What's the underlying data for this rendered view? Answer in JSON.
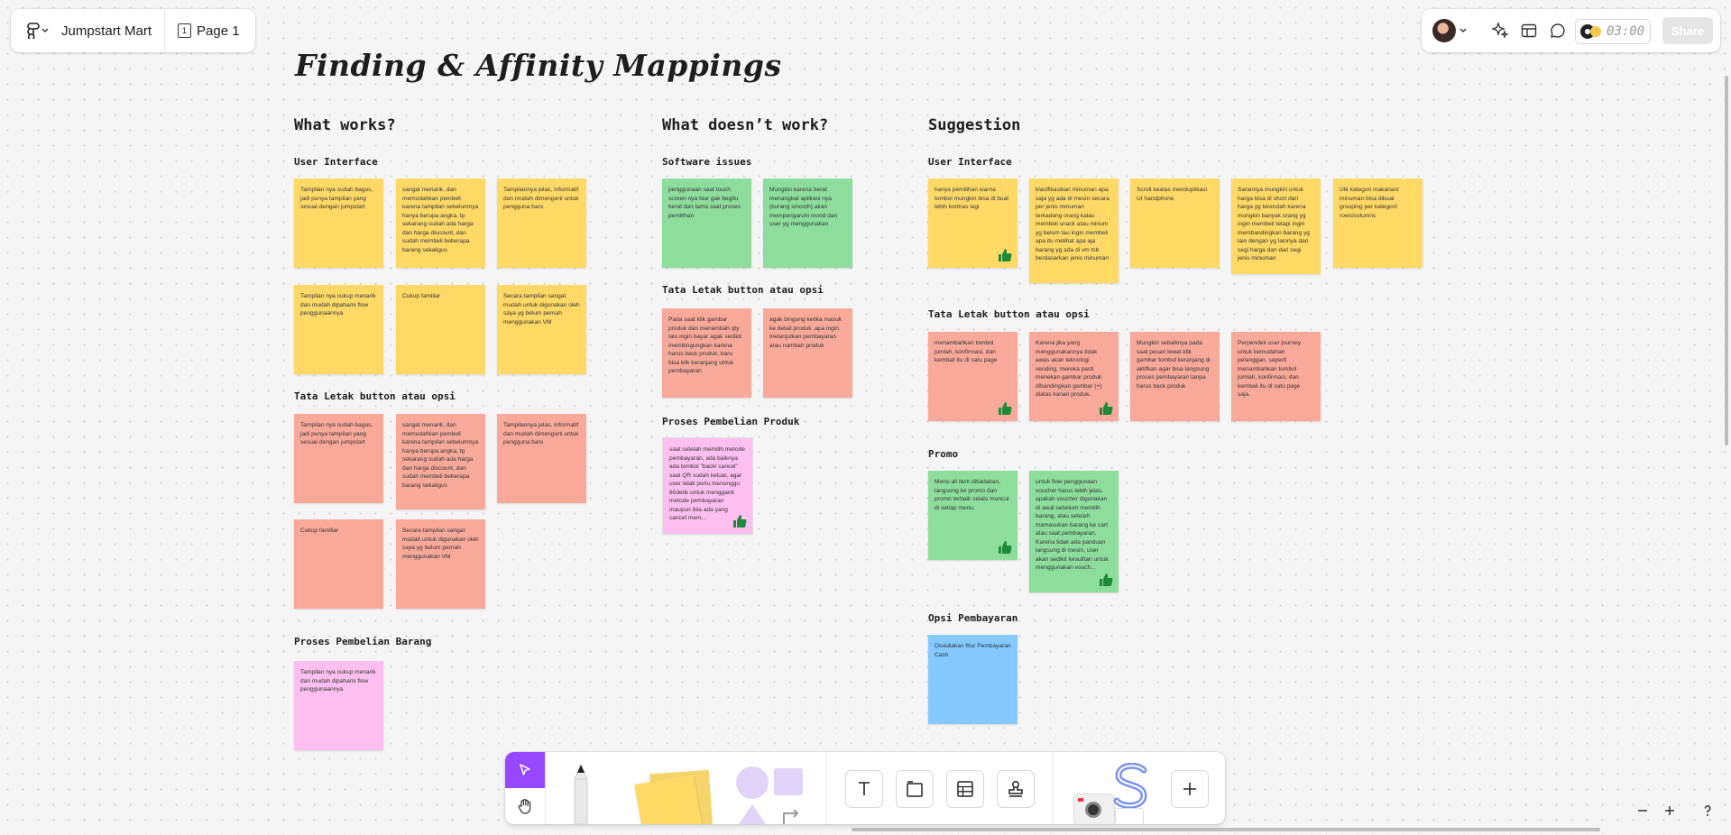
{
  "app": {
    "file_name": "Jumpstart Mart",
    "page_name": "Page 1",
    "page_number": "1",
    "timer": "03:00",
    "share_label": "Share"
  },
  "board": {
    "title": "Finding & Affinity Mappings",
    "columns": {
      "works": "What works?",
      "doesnt": "What doesn’t work?",
      "suggestion": "Suggestion"
    },
    "sections": {
      "works_ui": "User Interface",
      "works_layout": "Tata Letak button atau opsi",
      "works_purchase": "Proses Pembelian Barang",
      "doesnt_software": "Software issues",
      "doesnt_layout": "Tata Letak button atau opsi",
      "doesnt_purchase": "Proses Pembelian Produk",
      "sugg_ui": "User Interface",
      "sugg_layout": "Tata Letak button atau opsi",
      "sugg_promo": "Promo",
      "sugg_payment": "Opsi Pembayaran"
    }
  },
  "notes": {
    "w1": "Tampilan nya sudah bagus, jadi punya tampilan yang sesuai dengan jumpstart",
    "w2": "sangat menarik, dan memudahkan pembeli karena tampilan sebelumnya hanya berupa angka, tp sekarang sudah ada harga dan harga discount, dan sudah membeli beberapa barang sekaligus",
    "w3": "Tampilannya jelas, informatif dan mudah dimengerti untuk pengguna baru",
    "w4": "Tampilan nya cukup menarik dan mudah dipahami flow penggunaannya",
    "w5": "Cukup familiar",
    "w6": "Secara tampilan sangat mudah untuk digunakan oleh saya yg belum pernah menggunakan VM",
    "w7": "Tampilan nya sudah bagus, jadi punya tampilan yang sesuai dengan jumpstart",
    "w8": "sangat menarik, dan memudahkan pembeli karena tampilan sebelumnya hanya berupa angka, tp sekarang sudah ada harga dan harga discount, dan sudah membeli beberapa barang sekaligus",
    "w9": "Tampilannya jelas, informatif dan mudah dimengerti untuk pengguna baru",
    "w10": "Cukup familiar",
    "w11": "Secara tampilan sangat mudah untuk digunakan oleh saya yg belum pernah menggunakan VM",
    "w12": "Tampilan nya cukup menarik dan mudah dipahami flow penggunaannya",
    "d1": "penggunaan saat touch screen nya biar gak begitu berat dan lama saat proses pemilihan",
    "d2": "Mungkin karena berat menangkat aplikasi nya (kurang smooth) akan mempengaruhi mood dari user yg menggunakan",
    "d3": "Pada saat klik gambar produk dan menambah qty lalu ingin bayar agak sedikit membingungkan karena harus back produk, baru bisa klik keranjang untuk pembayaran",
    "d4": "agak bingung ketika masuk ke detail produk ,apa ingin melanjutkan pembayaran atau nambah produk",
    "d5": "saat setelah memilih metode pembayaran, ada baiknya ada tombol \"back/ cancel\" saat QR sudah keluar, agar user tidak perlu menunggu 60detik untuk mengganti metode pembayaran maupun bila ada yang cancel mem...",
    "s1": "hanya pemilihan warna tombol mungkin bisa di buat lebih kontras lagi",
    "s2": "klasifikasikan minuman apa saja yg ada di mesin secara per jenis minuman terkadang orang kalau membeli snack atau minum yg belum tau ingin membeli apa itu melihat apa aja barang yg ada di vm tsb berdasarkan jenis minuman",
    "s3": "Scroll keatas menduplikasi UI handphone",
    "s4": "Sarannya mungkin untuk harga bisa di short dari harga yg terendah karena mungkin banyak orang yg ingin membeli tetapi ingin membandingkan barang yg lain dengan yg lainnya dari segi harga dan dari segi jenis minuman",
    "s5": "Utk kategori makanan/ minuman bisa dibuat grouping per kategori/ rows/columns",
    "s6": "menambahkan tombol jumlah, konfirmasi, dan kembali itu di satu page",
    "s7": "Karena jika yang menggunakannya tidak awas akan teknologi vending, mereka pasti menekan gambar produk dibandingkan gambar (+) diatas kanan produk.",
    "s8": "Mungkin sebaiknya pada saat pesan lewat klik gambar tombol keranjang di aktifkan agar bisa langsung proses pembayaran tanpa harus back produk",
    "s9": "Perpendek user journey untuk kemudahan pelanggan, seperti menambahkan tombol jumlah, konfirmasi, dan kembali itu di satu page saja.",
    "s10": "Menu all item ditiadakan, langsung ke promo dan promo terbaik selalu muncul di setiap menu.",
    "s11": "untuk flow penggunaan voucher harus lebih jelas, apakah voucher digunakan di awal sebelum memilih barang, atau setelah memasukan barang ke cart atau saat pembayaran. Karena tidak ada panduan langsung di mesin, user akan sedikit kesulitan untuk menggunakan vouch...",
    "s12": "Disediakan fitur Pembayaran Cash"
  },
  "icons": {
    "logo": "figjam-logo-icon",
    "page": "page-icon",
    "ai": "ai-sparkle-icon",
    "layout": "layout-icon",
    "comment": "comment-icon",
    "thumb": "thumbs-up-icon"
  },
  "colors": {
    "yellow": "#ffd966",
    "red": "#f9a99a",
    "green": "#8ddd9c",
    "pink": "#fdbef0",
    "blue": "#84c9ff",
    "accent": "#9747ff"
  }
}
